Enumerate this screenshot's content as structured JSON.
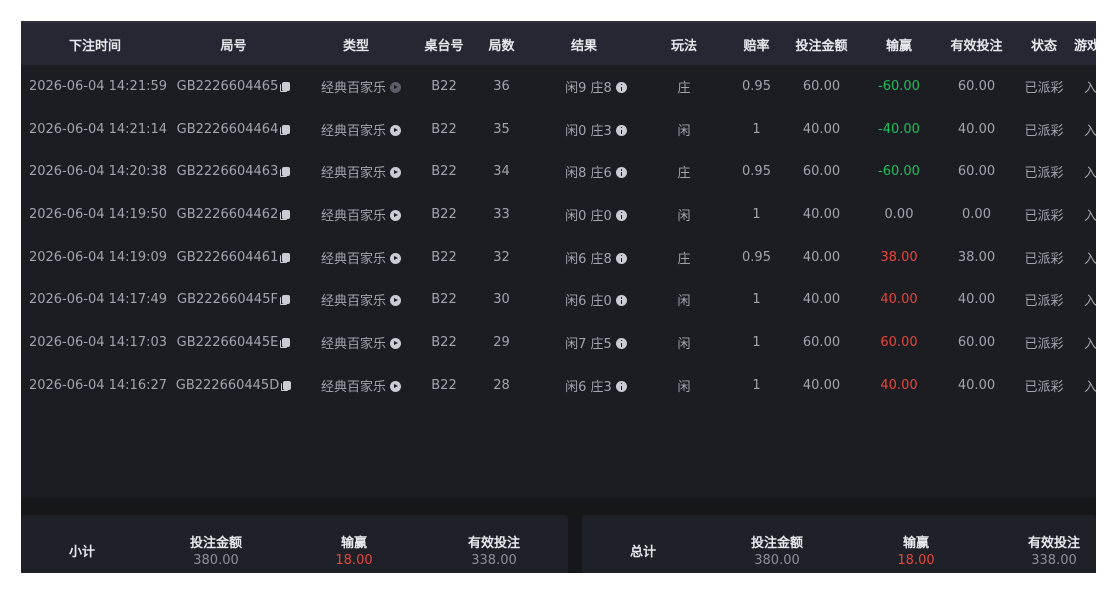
{
  "headers": [
    "下注时间",
    "局号",
    "类型",
    "桌台号",
    "局数",
    "结果",
    "玩法",
    "赔率",
    "投注金额",
    "输赢",
    "有效投注",
    "状态",
    "游戏"
  ],
  "rows": [
    {
      "time": "2026-06-04 14:21:59",
      "round_id": "GB2226604465",
      "type": "经典百家乐",
      "table": "B22",
      "round_no": "36",
      "result": "闲9 庄8",
      "bet": "庄",
      "odds": "0.95",
      "amount": "60.00",
      "winloss": "-60.00",
      "wl_sign": "neg",
      "valid": "60.00",
      "status": "已派彩",
      "game": "入",
      "play_dim": true
    },
    {
      "time": "2026-06-04 14:21:14",
      "round_id": "GB2226604464",
      "type": "经典百家乐",
      "table": "B22",
      "round_no": "35",
      "result": "闲0 庄3",
      "bet": "闲",
      "odds": "1",
      "amount": "40.00",
      "winloss": "-40.00",
      "wl_sign": "neg",
      "valid": "40.00",
      "status": "已派彩",
      "game": "入",
      "play_dim": false
    },
    {
      "time": "2026-06-04 14:20:38",
      "round_id": "GB2226604463",
      "type": "经典百家乐",
      "table": "B22",
      "round_no": "34",
      "result": "闲8 庄6",
      "bet": "庄",
      "odds": "0.95",
      "amount": "60.00",
      "winloss": "-60.00",
      "wl_sign": "neg",
      "valid": "60.00",
      "status": "已派彩",
      "game": "入",
      "play_dim": false
    },
    {
      "time": "2026-06-04 14:19:50",
      "round_id": "GB2226604462",
      "type": "经典百家乐",
      "table": "B22",
      "round_no": "33",
      "result": "闲0 庄0",
      "bet": "闲",
      "odds": "1",
      "amount": "40.00",
      "winloss": "0.00",
      "wl_sign": "zero",
      "valid": "0.00",
      "status": "已派彩",
      "game": "入",
      "play_dim": false
    },
    {
      "time": "2026-06-04 14:19:09",
      "round_id": "GB2226604461",
      "type": "经典百家乐",
      "table": "B22",
      "round_no": "32",
      "result": "闲6 庄8",
      "bet": "庄",
      "odds": "0.95",
      "amount": "40.00",
      "winloss": "38.00",
      "wl_sign": "pos",
      "valid": "38.00",
      "status": "已派彩",
      "game": "入",
      "play_dim": false
    },
    {
      "time": "2026-06-04 14:17:49",
      "round_id": "GB222660445F",
      "type": "经典百家乐",
      "table": "B22",
      "round_no": "30",
      "result": "闲6 庄0",
      "bet": "闲",
      "odds": "1",
      "amount": "40.00",
      "winloss": "40.00",
      "wl_sign": "pos",
      "valid": "40.00",
      "status": "已派彩",
      "game": "入",
      "play_dim": false
    },
    {
      "time": "2026-06-04 14:17:03",
      "round_id": "GB222660445E",
      "type": "经典百家乐",
      "table": "B22",
      "round_no": "29",
      "result": "闲7 庄5",
      "bet": "闲",
      "odds": "1",
      "amount": "60.00",
      "winloss": "60.00",
      "wl_sign": "pos",
      "valid": "60.00",
      "status": "已派彩",
      "game": "入",
      "play_dim": false
    },
    {
      "time": "2026-06-04 14:16:27",
      "round_id": "GB222660445D",
      "type": "经典百家乐",
      "table": "B22",
      "round_no": "28",
      "result": "闲6 庄3",
      "bet": "闲",
      "odds": "1",
      "amount": "40.00",
      "winloss": "40.00",
      "wl_sign": "pos",
      "valid": "40.00",
      "status": "已派彩",
      "game": "入",
      "play_dim": false
    }
  ],
  "subtotal": {
    "label": "小计",
    "amount_label": "投注金额",
    "amount": "380.00",
    "winloss_label": "输赢",
    "winloss": "18.00",
    "valid_label": "有效投注",
    "valid": "338.00"
  },
  "total": {
    "label": "总计",
    "amount_label": "投注金额",
    "amount": "380.00",
    "winloss_label": "输赢",
    "winloss": "18.00",
    "valid_label": "有效投注",
    "valid": "338.00"
  },
  "colors": {
    "background": "#1b1d23",
    "header": "#252833",
    "negative": "#1fbf5a",
    "positive": "#e8443a"
  },
  "icons": {
    "copy": "copy-icon",
    "replay": "play-circle-icon",
    "detail": "info-circle-icon"
  }
}
